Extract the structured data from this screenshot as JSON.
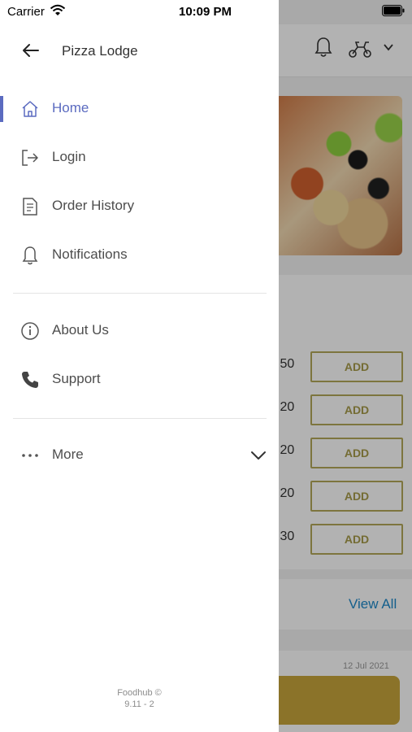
{
  "status_bar": {
    "carrier": "Carrier",
    "time": "10:09 PM"
  },
  "drawer": {
    "title": "Pizza Lodge",
    "items": [
      {
        "label": "Home",
        "icon": "home-icon",
        "active": true
      },
      {
        "label": "Login",
        "icon": "login-icon"
      },
      {
        "label": "Order History",
        "icon": "receipt-icon"
      },
      {
        "label": "Notifications",
        "icon": "bell-icon"
      },
      {
        "label": "About Us",
        "icon": "info-icon"
      },
      {
        "label": "Support",
        "icon": "phone-icon"
      },
      {
        "label": "More",
        "icon": "more-dots-icon"
      }
    ],
    "footer": {
      "line1": "Foodhub ©",
      "line2": "9.11 - 2"
    }
  },
  "background": {
    "prices": [
      ".50",
      ".20",
      ".20",
      ".20",
      ".30"
    ],
    "add_label": "ADD",
    "view_all": "View All",
    "date": "12 Jul 2021"
  },
  "colors": {
    "accent": "#5b6bc0",
    "add_border": "#b3a85a",
    "view_all": "#1e88c9",
    "cart": "#c8a53b"
  }
}
